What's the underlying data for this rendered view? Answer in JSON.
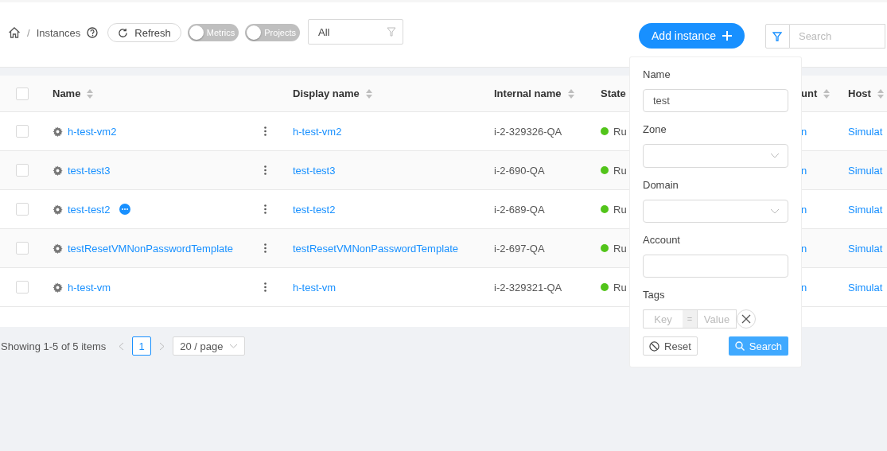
{
  "breadcrumb": {
    "separator": "/",
    "items": [
      "Instances"
    ]
  },
  "toolbar": {
    "refresh": "Refresh",
    "toggles": [
      {
        "label": "Metrics",
        "on": false
      },
      {
        "label": "Projects",
        "on": false
      }
    ],
    "filter_select": "All",
    "add_button": "Add instance",
    "search": {
      "placeholder": "Search"
    }
  },
  "table": {
    "select_all_checked": false,
    "columns": [
      {
        "label": "Name",
        "sortable": true
      },
      {
        "label": "Display name",
        "sortable": true
      },
      {
        "label": "Internal name",
        "sortable": true
      },
      {
        "label": "State",
        "sortable": false
      },
      {
        "label": "unt",
        "sortable": true
      },
      {
        "label": "Host",
        "sortable": true
      }
    ],
    "rows": [
      {
        "name": "h-test-vm2",
        "comment": false,
        "display_name": "h-test-vm2",
        "internal_name": "i-2-329326-QA",
        "state": "Ru",
        "account": "n",
        "host": "Simulat",
        "checked": false
      },
      {
        "name": "test-test3",
        "comment": false,
        "display_name": "test-test3",
        "internal_name": "i-2-690-QA",
        "state": "Ru",
        "account": "n",
        "host": "Simulat",
        "checked": false
      },
      {
        "name": "test-test2",
        "comment": true,
        "display_name": "test-test2",
        "internal_name": "i-2-689-QA",
        "state": "Ru",
        "account": "n",
        "host": "Simulat",
        "checked": false
      },
      {
        "name": "testResetVMNonPasswordTemplate",
        "comment": false,
        "display_name": "testResetVMNonPasswordTemplate",
        "internal_name": "i-2-697-QA",
        "state": "Ru",
        "account": "n",
        "host": "Simulat",
        "checked": false
      },
      {
        "name": "h-test-vm",
        "comment": false,
        "display_name": "h-test-vm",
        "internal_name": "i-2-329321-QA",
        "state": "Ru",
        "account": "n",
        "host": "Simulat",
        "checked": false
      }
    ]
  },
  "pagination": {
    "summary": "Showing 1-5 of 5 items",
    "pages": [
      {
        "label": "1",
        "selected": true
      }
    ],
    "page_size": "20 / page"
  },
  "filter_panel": {
    "fields": [
      {
        "kind": "text",
        "label": "Name",
        "value": "test"
      },
      {
        "kind": "select",
        "label": "Zone"
      },
      {
        "kind": "select",
        "label": "Domain"
      },
      {
        "kind": "text",
        "label": "Account"
      },
      {
        "kind": "tags",
        "label": "Tags",
        "key_placeholder": "Key",
        "separator": "=",
        "value_placeholder": "Value"
      }
    ],
    "reset": "Reset",
    "search": "Search"
  }
}
